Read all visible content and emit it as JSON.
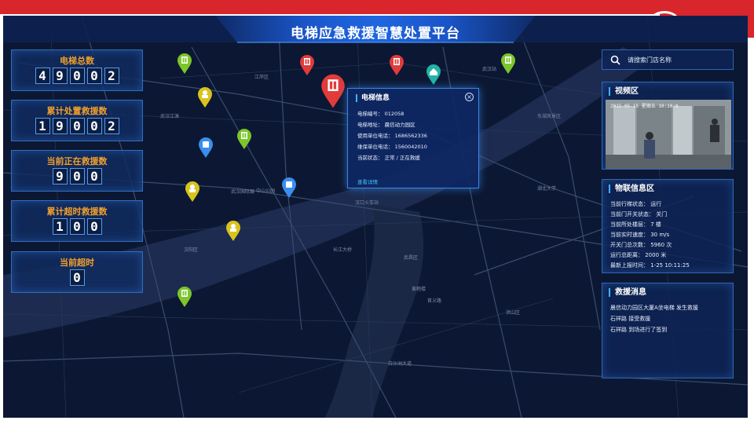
{
  "title": "电梯应急救援智慧处置平台",
  "stats": [
    {
      "label": "电梯总数",
      "digits": [
        "4",
        "9",
        "0",
        "0",
        "2"
      ]
    },
    {
      "label": "累计处置救援数",
      "digits": [
        "1",
        "9",
        "0",
        "0",
        "2"
      ]
    },
    {
      "label": "当前正在救援数",
      "digits": [
        "9",
        "0",
        "0"
      ]
    },
    {
      "label": "累计超时救援数",
      "digits": [
        "1",
        "0",
        "0"
      ]
    },
    {
      "label": "当前超时",
      "digits": [
        "0"
      ]
    }
  ],
  "search": {
    "placeholder": "请搜索门店名称"
  },
  "video": {
    "title": "视频区",
    "timestamp": "2015-05-15 星期五 10:10:0"
  },
  "iot": {
    "title": "物联信息区",
    "lines": [
      "当前行梯状态： 运行",
      "当前门开关状态： 关门",
      "当前所处楼层： 7 楼",
      "当前实时速度： 30 m/s",
      "开关门总次数： 5960 次",
      "运行总距离： 2000 米",
      "最新上报时间： 1-25 10:11:25"
    ]
  },
  "rescue": {
    "title": "救援消息",
    "lines": [
      "晨信动力园区大厦A坐电梯  发生救援",
      "石祥路  接受救援",
      "石祥路  到场进行了签到"
    ]
  },
  "popup": {
    "title": "电梯信息",
    "lines": [
      "电梯编号：  012058",
      "电梯地址：  晨信动力园区",
      "使用单位电话：  1686562336",
      "维保单位电话：  1560042010",
      "当前状态：  正常 / 正在救援"
    ],
    "link": "查看详情"
  },
  "map_labels": [
    "武汉江滩",
    "中山公园",
    "武汉国际展",
    "汉口火车站",
    "长江大桥",
    "武昌区",
    "东湖风景区",
    "武汉站",
    "汉阳区",
    "江岸区",
    "洪山区",
    "白沙洲大道",
    "黄鹤楼",
    "首义路",
    "湖北大学"
  ],
  "colors": {
    "accent": "#40b0ff",
    "stat_label": "#f3a12c",
    "pin_red": "#e23b3b",
    "pin_green": "#7cc62b",
    "pin_yellow": "#d8c41c",
    "pin_blue": "#3a8ef0",
    "pin_teal": "#23b3a7"
  }
}
